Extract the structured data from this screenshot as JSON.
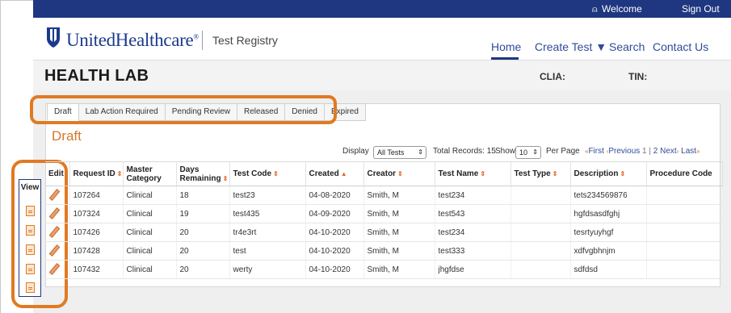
{
  "topbar": {
    "welcome": "Welcome",
    "sign_out": "Sign Out"
  },
  "brand": {
    "name": "UnitedHealthcare",
    "registered": "®",
    "product": "Test Registry"
  },
  "nav": {
    "home": "Home",
    "create_test": "Create Test ▼",
    "search": "Search",
    "contact": "Contact Us"
  },
  "lab": {
    "title": "HEALTH LAB",
    "clia_label": "CLIA:",
    "tin_label": "TIN:"
  },
  "tabs": [
    "Draft",
    "Lab Action Required",
    "Pending Review",
    "Released",
    "Denied",
    "Expired"
  ],
  "section_title": "Draft",
  "controls": {
    "display_label": "Display",
    "display_value": "All Tests",
    "total_records": "Total Records: 15",
    "show_label": "Show",
    "show_value": "10",
    "per_page": "Per Page"
  },
  "pager": {
    "first": "First",
    "previous": "Previous",
    "page_current": "1",
    "page_next_num": "2",
    "next": "Next",
    "last": "Last"
  },
  "view_column": {
    "header": "View"
  },
  "table": {
    "headers": [
      "Edit",
      "Request ID",
      "Master Category",
      "Days Remaining",
      "Test Code",
      "Created",
      "Creator",
      "Test Name",
      "Test Type",
      "Description",
      "Procedure Code"
    ],
    "rows": [
      [
        "107264",
        "Clinical",
        "18",
        "test23",
        "04-08-2020",
        "Smith, M",
        "test234",
        "",
        "tets234569876",
        ""
      ],
      [
        "107324",
        "Clinical",
        "19",
        "test435",
        "04-09-2020",
        "Smith, M",
        "test543",
        "",
        "hgfdsasdfghj",
        ""
      ],
      [
        "107426",
        "Clinical",
        "20",
        "tr4e3rt",
        "04-10-2020",
        "Smith, M",
        "test234",
        "",
        "tesrtyuyhgf",
        ""
      ],
      [
        "107428",
        "Clinical",
        "20",
        "test",
        "04-10-2020",
        "Smith, M",
        "test333",
        "",
        "xdfvgbhnjm",
        ""
      ],
      [
        "107432",
        "Clinical",
        "20",
        "werty",
        "04-10-2020",
        "Smith, M",
        "jhgfdse",
        "",
        "sdfdsd",
        ""
      ]
    ]
  },
  "colors": {
    "brand_blue": "#1f3680",
    "accent_orange": "#e07a22",
    "link_blue": "#2f4c9a"
  },
  "icons": {
    "user": "user-icon",
    "edit": "pencil-icon",
    "view": "document-icon",
    "sort": "sort-arrows-icon"
  }
}
